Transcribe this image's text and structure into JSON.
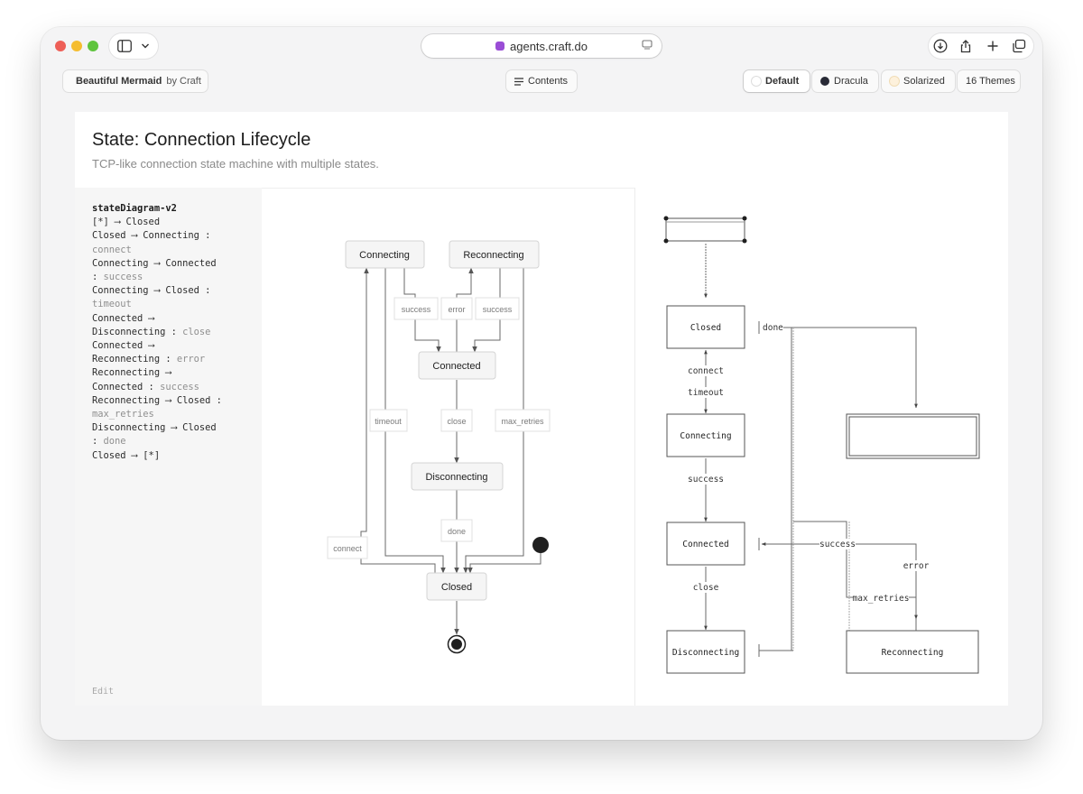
{
  "browser": {
    "url": "agents.craft.do"
  },
  "toolbar": {
    "brand_name": "Beautiful Mermaid",
    "brand_by": "by Craft",
    "contents_label": "Contents",
    "themes": [
      {
        "label": "Default",
        "swatch": "#ffffff",
        "active": true
      },
      {
        "label": "Dracula",
        "swatch": "#282a36",
        "active": false
      },
      {
        "label": "Solarized",
        "swatch": "#fdf1dc",
        "active": false
      }
    ],
    "more_themes_label": "16 Themes"
  },
  "example": {
    "title": "State: Connection Lifecycle",
    "subtitle": "TCP-like connection state machine with multiple states.",
    "edit_label": "Edit"
  },
  "code_lines": [
    [
      {
        "t": "stateDiagram-v2",
        "c": "kw"
      }
    ],
    [
      {
        "t": "  [*] ⟶ Closed",
        "c": ""
      }
    ],
    [
      {
        "t": "  Closed ⟶ Connecting :",
        "c": ""
      }
    ],
    [
      {
        "t": "connect",
        "c": "muted"
      }
    ],
    [
      {
        "t": "  Connecting ⟶ Connected",
        "c": ""
      }
    ],
    [
      {
        "t": ": ",
        "c": ""
      },
      {
        "t": "success",
        "c": "muted"
      }
    ],
    [
      {
        "t": "  Connecting ⟶ Closed :",
        "c": ""
      }
    ],
    [
      {
        "t": "timeout",
        "c": "muted"
      }
    ],
    [
      {
        "t": "  Connected ⟶",
        "c": ""
      }
    ],
    [
      {
        "t": "Disconnecting : ",
        "c": ""
      },
      {
        "t": "close",
        "c": "muted"
      }
    ],
    [
      {
        "t": "  Connected ⟶",
        "c": ""
      }
    ],
    [
      {
        "t": "Reconnecting : ",
        "c": ""
      },
      {
        "t": "error",
        "c": "muted"
      }
    ],
    [
      {
        "t": "  Reconnecting ⟶",
        "c": ""
      }
    ],
    [
      {
        "t": "Connected : ",
        "c": ""
      },
      {
        "t": "success",
        "c": "muted"
      }
    ],
    [
      {
        "t": "  Reconnecting ⟶ Closed :",
        "c": ""
      }
    ],
    [
      {
        "t": "max_retries",
        "c": "muted"
      }
    ],
    [
      {
        "t": "  Disconnecting ⟶ Closed",
        "c": ""
      }
    ],
    [
      {
        "t": ": ",
        "c": ""
      },
      {
        "t": "done",
        "c": "muted"
      }
    ],
    [
      {
        "t": "  Closed ⟶ [*]",
        "c": ""
      }
    ]
  ],
  "diagram": {
    "states": {
      "connecting": "Connecting",
      "reconnecting": "Reconnecting",
      "connected": "Connected",
      "disconnecting": "Disconnecting",
      "closed": "Closed"
    },
    "edge_labels": {
      "success_1": "success",
      "error": "error",
      "success_2": "success",
      "timeout": "timeout",
      "close": "close",
      "max_retries": "max_retries",
      "done": "done",
      "connect": "connect"
    }
  },
  "ascii": {
    "states": {
      "closed": "Closed",
      "connecting": "Connecting",
      "connected": "Connected",
      "disconnecting": "Disconnecting",
      "reconnecting": "Reconnecting"
    },
    "labels": {
      "done": "done",
      "connect": "connect",
      "timeout": "timeout",
      "success": "success",
      "close": "close",
      "success_right": "success",
      "error": "error",
      "max_retries": "max_retries"
    }
  },
  "colors": {
    "accent_code": "#2b2b2b",
    "muted_code": "#8f8f8f",
    "node_fill": "#f5f5f5",
    "node_border": "#d4d4d4",
    "edge": "#5a5a5a"
  }
}
